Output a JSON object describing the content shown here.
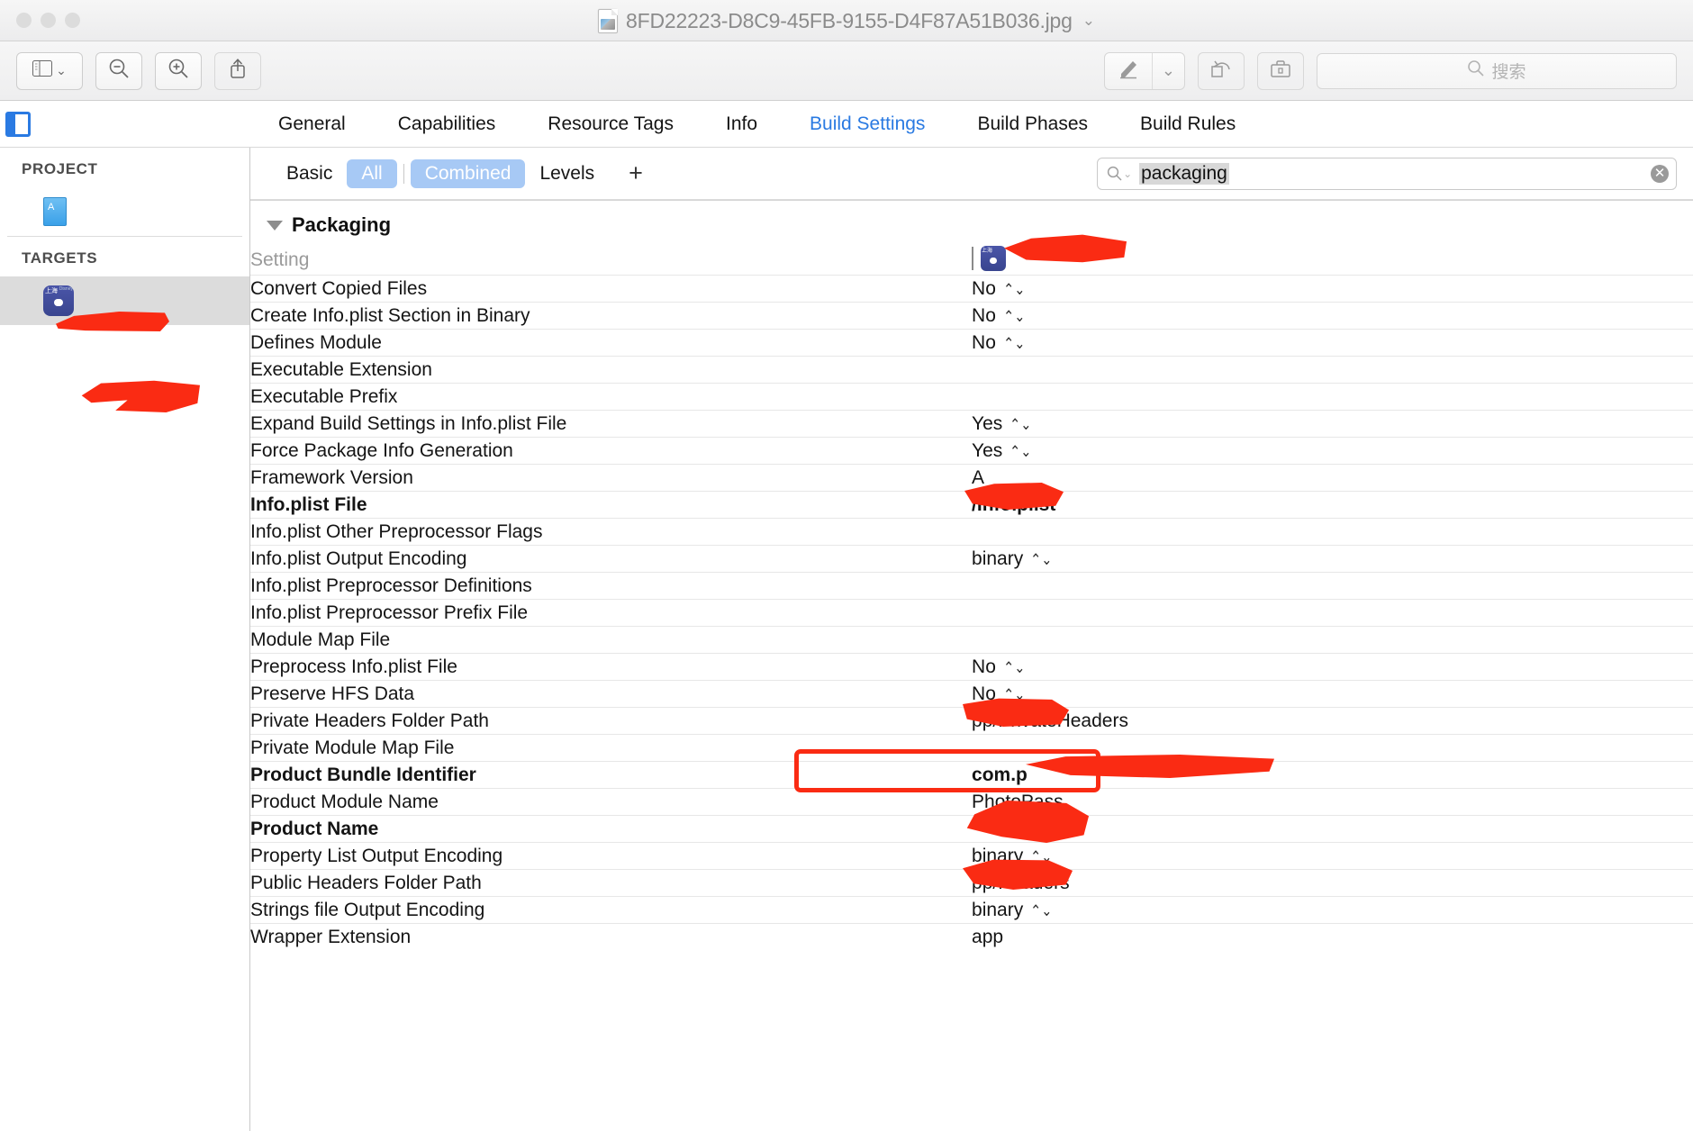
{
  "window": {
    "title": "8FD22223-D8C9-45FB-9155-D4F87A51B036.jpg",
    "title_chevron": "⌄",
    "traffic_lights": [
      "close",
      "minimize",
      "zoom"
    ]
  },
  "toolbar": {
    "sidebar_button": "sidebar-icon",
    "sidebar_chevron": "⌄",
    "zoom_out": "zoom-out-icon",
    "zoom_in": "zoom-in-icon",
    "share": "share-icon",
    "markup": "markup-pen-icon",
    "markup_chevron": "⌄",
    "rotate": "rotate-icon",
    "toolbox": "markup-toolbox-icon",
    "search_placeholder": "搜索",
    "search_icon": "search-icon"
  },
  "editor": {
    "nav_toggle": "navigator-toggle-icon",
    "tabs": [
      {
        "label": "General",
        "active": false
      },
      {
        "label": "Capabilities",
        "active": false
      },
      {
        "label": "Resource Tags",
        "active": false
      },
      {
        "label": "Info",
        "active": false
      },
      {
        "label": "Build Settings",
        "active": true
      },
      {
        "label": "Build Phases",
        "active": false
      },
      {
        "label": "Build Rules",
        "active": false
      }
    ]
  },
  "sidebar": {
    "project_header": "PROJECT",
    "targets_header": "TARGETS",
    "project_item": {
      "name": "",
      "redacted": true
    },
    "target_item": {
      "name": "",
      "redacted": true,
      "selected": true
    }
  },
  "filterbar": {
    "items": [
      {
        "label": "Basic",
        "selected": false
      },
      {
        "label": "All",
        "selected": true
      },
      {
        "label": "Combined",
        "selected": true
      },
      {
        "label": "Levels",
        "selected": false
      }
    ],
    "add_label": "+",
    "search_value": "packaging",
    "search_icon": "search-icon",
    "search_chevron": "⌄",
    "clear_label": "✕"
  },
  "table": {
    "group_title": "Packaging",
    "col_setting_header": "Setting",
    "col_target_header": {
      "name": "",
      "redacted": true
    },
    "rows": [
      {
        "name": "Convert Copied Files",
        "value": "No",
        "stepper": true,
        "bold": false
      },
      {
        "name": "Create Info.plist Section in Binary",
        "value": "No",
        "stepper": true,
        "bold": false
      },
      {
        "name": "Defines Module",
        "value": "No",
        "stepper": true,
        "bold": false
      },
      {
        "name": "Executable Extension",
        "value": "",
        "stepper": false,
        "bold": false
      },
      {
        "name": "Executable Prefix",
        "value": "",
        "stepper": false,
        "bold": false
      },
      {
        "name": "Expand Build Settings in Info.plist File",
        "value": "Yes",
        "stepper": true,
        "bold": false
      },
      {
        "name": "Force Package Info Generation",
        "value": "Yes",
        "stepper": true,
        "bold": false
      },
      {
        "name": "Framework Version",
        "value": "A",
        "stepper": false,
        "bold": false
      },
      {
        "name": "Info.plist File",
        "value": "/Info.plist",
        "stepper": false,
        "bold": true,
        "redact": "m-infoplist"
      },
      {
        "name": "Info.plist Other Preprocessor Flags",
        "value": "",
        "stepper": false,
        "bold": false
      },
      {
        "name": "Info.plist Output Encoding",
        "value": "binary",
        "stepper": true,
        "bold": false
      },
      {
        "name": "Info.plist Preprocessor Definitions",
        "value": "",
        "stepper": false,
        "bold": false
      },
      {
        "name": "Info.plist Preprocessor Prefix File",
        "value": "",
        "stepper": false,
        "bold": false
      },
      {
        "name": "Module Map File",
        "value": "",
        "stepper": false,
        "bold": false
      },
      {
        "name": "Preprocess Info.plist File",
        "value": "No",
        "stepper": true,
        "bold": false
      },
      {
        "name": "Preserve HFS Data",
        "value": "No",
        "stepper": true,
        "bold": false
      },
      {
        "name": "Private Headers Folder Path",
        "value": "pp/PrivateHeaders",
        "stepper": false,
        "bold": false,
        "redact": "m-priv"
      },
      {
        "name": "Private Module Map File",
        "value": "",
        "stepper": false,
        "bold": false
      },
      {
        "name": "Product Bundle Identifier",
        "value": "com.p",
        "stepper": false,
        "bold": true,
        "redact": "m-bundle",
        "highlighted": true
      },
      {
        "name": "Product Module Name",
        "value": "PhotoPass",
        "stepper": false,
        "bold": false
      },
      {
        "name": "Product Name",
        "value": "",
        "stepper": false,
        "bold": true,
        "redact": "m-prodname"
      },
      {
        "name": "Property List Output Encoding",
        "value": "binary",
        "stepper": true,
        "bold": false
      },
      {
        "name": "Public Headers Folder Path",
        "value": "pp/Headers",
        "stepper": false,
        "bold": false,
        "redact": "m-pub"
      },
      {
        "name": "Strings file Output Encoding",
        "value": "binary",
        "stepper": true,
        "bold": false
      },
      {
        "name": "Wrapper Extension",
        "value": "app",
        "stepper": false,
        "bold": false
      }
    ]
  },
  "colors": {
    "accent": "#2a7ae2",
    "selected_pill": "#a7c9f5",
    "redaction": "#fa2b13",
    "row_divider": "#e7e7e7"
  }
}
